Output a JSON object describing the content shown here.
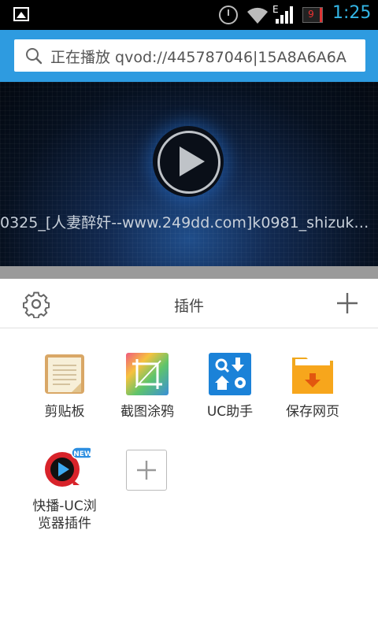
{
  "status_bar": {
    "network_type": "E",
    "battery_level": "9",
    "time": "1:25",
    "accent_color": "#33b5e5"
  },
  "address_bar": {
    "text": "正在播放 qvod://445787046|15A8A6A6A",
    "background_color": "#2e9be0"
  },
  "video": {
    "title": "0325_[人妻醉奸--www.249dd.com]k0981_shizuk…"
  },
  "plugin_panel": {
    "title": "插件",
    "plugins": [
      {
        "label": "剪贴板",
        "icon": "clipboard-icon"
      },
      {
        "label": "截图涂鸦",
        "icon": "screenshot-doodle-icon"
      },
      {
        "label": "UC助手",
        "icon": "uc-helper-icon"
      },
      {
        "label": "保存网页",
        "icon": "save-page-folder-icon"
      },
      {
        "label_line1": "快播-UC浏",
        "label_line2": "览器插件",
        "icon": "qvod-player-icon",
        "badge": "NEW"
      }
    ]
  }
}
